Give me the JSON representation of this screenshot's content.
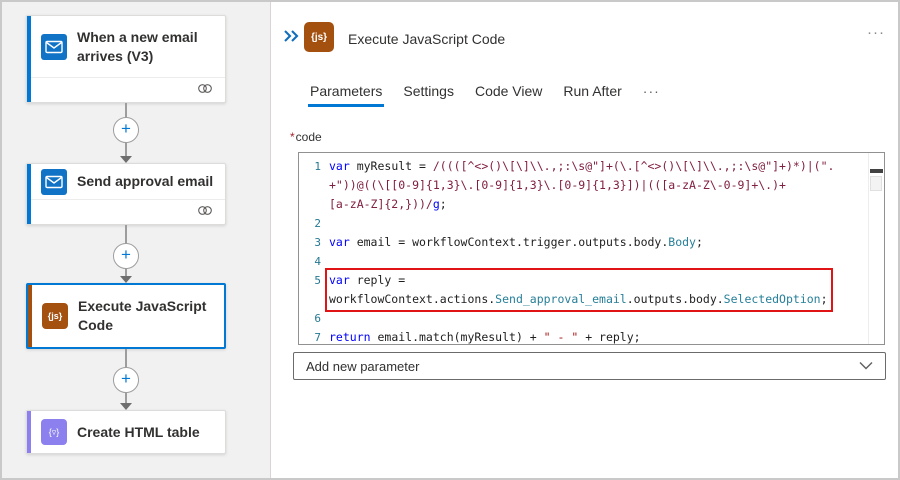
{
  "flow": {
    "steps": [
      {
        "label": "When a new email arrives (V3)",
        "icon": "outlook-mail-icon",
        "accent": "#0078d4",
        "has_footer": true
      },
      {
        "label": "Send approval email",
        "icon": "outlook-mail-icon",
        "accent": "#0078d4",
        "has_footer": true
      },
      {
        "label": "Execute JavaScript Code",
        "icon": "js-code-icon",
        "accent": "#a4500f",
        "selected": true
      },
      {
        "label": "Create HTML table",
        "icon": "html-table-icon",
        "accent": "#8b80ed"
      }
    ]
  },
  "panel": {
    "header": {
      "title": "Execute JavaScript Code",
      "more_label": "···"
    },
    "tabs": [
      {
        "label": "Parameters",
        "active": true
      },
      {
        "label": "Settings"
      },
      {
        "label": "Code View"
      },
      {
        "label": "Run After"
      },
      {
        "label": "···"
      }
    ],
    "code_field": {
      "required_marker": "*",
      "label": "code"
    },
    "add_parameter_label": "Add new parameter"
  },
  "icon_glyphs": {
    "js_badge": "{js}",
    "table_badge": "{▿}"
  },
  "code_editor": {
    "rows": [
      {
        "num": "1",
        "segments": [
          {
            "cls": "kw",
            "text": "var"
          },
          {
            "cls": "pl",
            "text": " myResult = "
          },
          {
            "cls": "rx",
            "text": "/((([^<>()\\[\\]\\\\.,;:\\s@\"]+(\\.[^<>()\\[\\]\\\\.,;:\\s@\"]+)*)|(\"."
          }
        ]
      },
      {
        "num": "",
        "segments": [
          {
            "cls": "rx",
            "text": "+\"))@((\\[[0-9]{1,3}\\.[0-9]{1,3}\\.[0-9]{1,3}])|(([a-zA-Z\\-0-9]+\\.)+"
          }
        ]
      },
      {
        "num": "",
        "segments": [
          {
            "cls": "rx",
            "text": "[a-zA-Z]{2,}))/"
          },
          {
            "cls": "flag",
            "text": "g"
          },
          {
            "cls": "pl",
            "text": ";"
          }
        ]
      },
      {
        "num": "2",
        "segments": []
      },
      {
        "num": "3",
        "segments": [
          {
            "cls": "kw",
            "text": "var"
          },
          {
            "cls": "pl",
            "text": " email = workflowContext.trigger.outputs.body."
          },
          {
            "cls": "type",
            "text": "Body"
          },
          {
            "cls": "pl",
            "text": ";"
          }
        ]
      },
      {
        "num": "4",
        "segments": []
      },
      {
        "num": "5",
        "segments": [
          {
            "cls": "kw",
            "text": "var"
          },
          {
            "cls": "pl",
            "text": " reply ="
          }
        ]
      },
      {
        "num": "",
        "segments": [
          {
            "cls": "pl",
            "text": "workflowContext.actions."
          },
          {
            "cls": "type",
            "text": "Send_approval_email"
          },
          {
            "cls": "pl",
            "text": ".outputs.body."
          },
          {
            "cls": "type",
            "text": "SelectedOption"
          },
          {
            "cls": "pl",
            "text": ";"
          }
        ]
      },
      {
        "num": "6",
        "segments": []
      },
      {
        "num": "7",
        "segments": [
          {
            "cls": "kw",
            "text": "return"
          },
          {
            "cls": "pl",
            "text": " email.match(myResult) + "
          },
          {
            "cls": "str",
            "text": "\" - \""
          },
          {
            "cls": "pl",
            "text": " + reply;"
          }
        ]
      }
    ]
  },
  "colors": {
    "accent_blue": "#0078d4",
    "js_orange": "#a4500f",
    "table_purple": "#8b80ed",
    "highlight_red": "#e01414",
    "keyword": "#0000ff",
    "regex": "#811f3f",
    "string": "#a31515",
    "type_name": "#267f99",
    "line_number": "#237893",
    "left_panel_bg": "#f1f1f1"
  }
}
